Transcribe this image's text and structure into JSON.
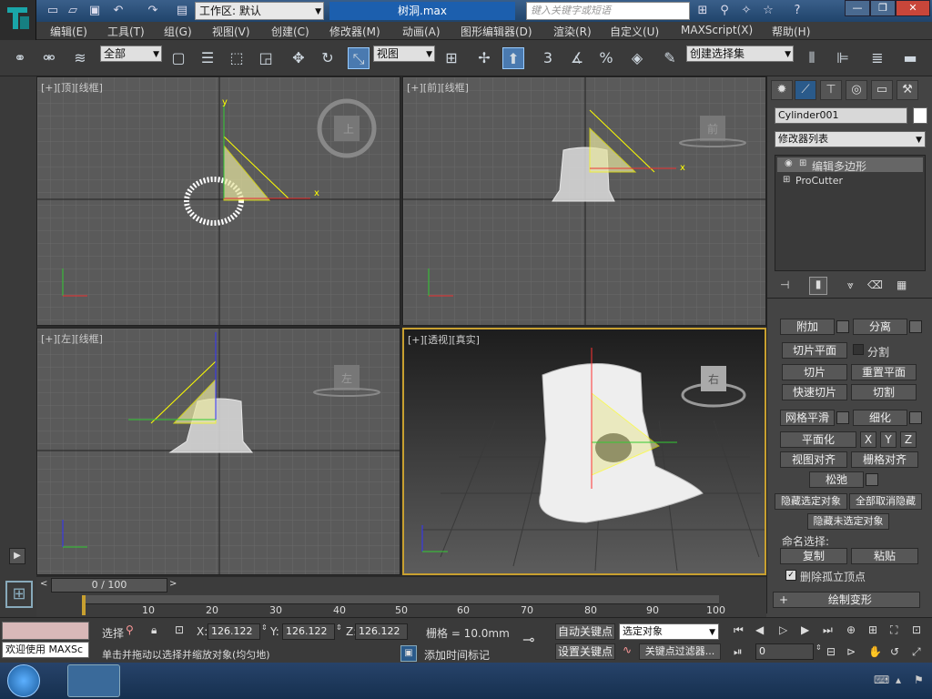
{
  "title": {
    "workspace_label": "工作区: 默认",
    "document": "树洞.max",
    "search_placeholder": "键入关键字或短语"
  },
  "menu": [
    "编辑(E)",
    "工具(T)",
    "组(G)",
    "视图(V)",
    "创建(C)",
    "修改器(M)",
    "动画(A)",
    "图形编辑器(D)",
    "渲染(R)",
    "自定义(U)",
    "MAXScript(X)",
    "帮助(H)"
  ],
  "toolbar": {
    "filter": "全部",
    "ref_coord": "视图",
    "snap_angle": "3",
    "named_selection": "创建选择集"
  },
  "viewports": {
    "top": "[+][顶][线框]",
    "front": "[+][前][线框]",
    "left": "[+][左][线框]",
    "persp": "[+][透视][真实]",
    "cube_top": "上",
    "cube_front": "前",
    "cube_left": "左",
    "cube_persp": "右"
  },
  "command_panel": {
    "object_name": "Cylinder001",
    "modifier_list": "修改器列表",
    "stack": [
      "编辑多边形",
      "ProCutter"
    ],
    "buttons": {
      "attach": "附加",
      "detach": "分离",
      "slice_plane": "切片平面",
      "split": "分割",
      "slice": "切片",
      "reset_plane": "重置平面",
      "quick_slice": "快速切片",
      "cut": "切割",
      "msmooth": "网格平滑",
      "tessellate": "细化",
      "make_planar": "平面化",
      "x": "X",
      "y": "Y",
      "z": "Z",
      "view_align": "视图对齐",
      "grid_align": "栅格对齐",
      "relax": "松弛",
      "hide_selected": "隐藏选定对象",
      "unhide_all": "全部取消隐藏",
      "hide_unselected": "隐藏未选定对象",
      "named_selections": "命名选择:",
      "copy": "复制",
      "paste": "粘贴",
      "delete_isolated": "删除孤立顶点",
      "paint_deform": "绘制变形"
    }
  },
  "timeline": {
    "frame": "0 / 100",
    "ticks": [
      "10",
      "20",
      "30",
      "40",
      "50",
      "60",
      "70",
      "80",
      "90",
      "100"
    ]
  },
  "status": {
    "welcome": "欢迎使用 MAXSc",
    "select_prefix": "选择",
    "x_label": "X:",
    "y_label": "Y:",
    "z_label": "Z:",
    "x": "126.122",
    "y": "126.122",
    "z": "126.122",
    "grid": "栅格 = 10.0mm",
    "auto_key": "自动关键点",
    "selected_obj": "选定对象",
    "set_key": "设置关键点",
    "key_filters": "关键点过滤器...",
    "prompt": "单击并拖动以选择并缩放对象(均匀地)",
    "add_time_tag": "添加时间标记",
    "frame_field": "0"
  },
  "colors": {
    "accent": "#c8a030",
    "title_blue": "#1c5fae"
  }
}
